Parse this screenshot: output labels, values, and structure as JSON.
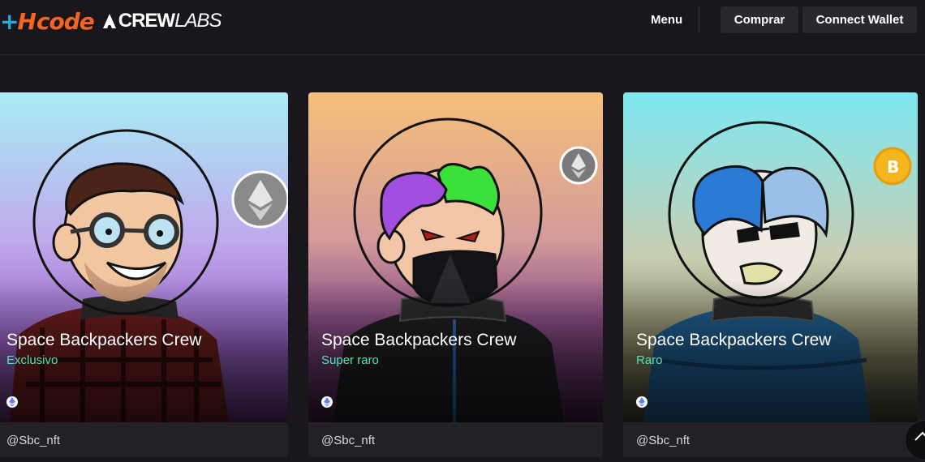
{
  "header": {
    "logo_mark": "H",
    "logo_code": "code",
    "logo_crew": "CREW",
    "logo_labs": "LABS",
    "menu_label": "Menu",
    "buy_label": "Comprar",
    "wallet_label": "Connect Wallet"
  },
  "cards": [
    {
      "title": "Space Backpackers Crew",
      "rarity": "Exclusivo",
      "handle": "@Sbc_nft",
      "coin": "ethereum-icon",
      "bg_top": "#a8e6f2",
      "bg_bottom": "#b07de0"
    },
    {
      "title": "Space Backpackers Crew",
      "rarity": "Super raro",
      "handle": "@Sbc_nft",
      "coin": "ethereum-icon",
      "bg_top": "#f4c27a",
      "bg_bottom": "#7a3f8a"
    },
    {
      "title": "Space Backpackers Crew",
      "rarity": "Raro",
      "handle": "@Sbc_nft",
      "coin": "bitcoin-icon",
      "bg_top": "#7ee8f0",
      "bg_bottom": "#c9cf9a"
    }
  ],
  "colors": {
    "background": "#1a171c",
    "rarity_accent": "#4ee6b4",
    "logo_orange": "#f26522",
    "logo_blue": "#2aa7df"
  }
}
